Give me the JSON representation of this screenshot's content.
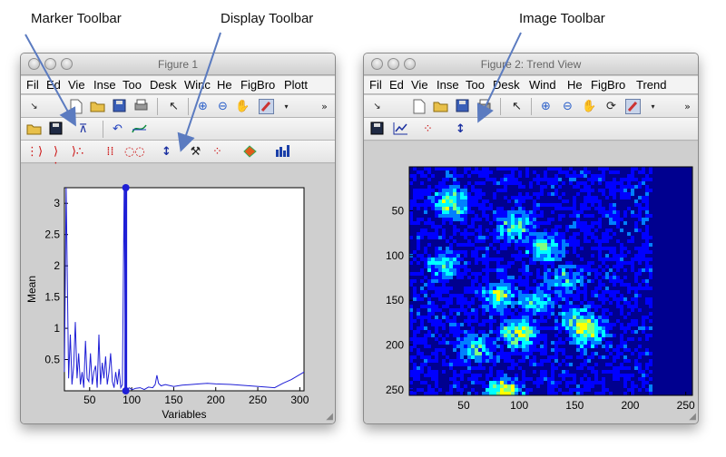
{
  "callouts": {
    "marker": "Marker Toolbar",
    "display": "Display Toolbar",
    "image": "Image Toolbar"
  },
  "window1": {
    "title": "Figure 1",
    "menu": [
      "Fil",
      "Ed",
      "Vie",
      "Inse",
      "Too",
      "Desk",
      "Winc",
      "He",
      "FigBro",
      "Plott"
    ],
    "chart_data": {
      "type": "line",
      "xlabel": "Variables",
      "ylabel": "Mean",
      "xlim": [
        20,
        305
      ],
      "ylim": [
        0,
        3.25
      ],
      "xticks": [
        50,
        100,
        150,
        200,
        250,
        300
      ],
      "yticks": [
        0.5,
        1,
        1.5,
        2,
        2.5,
        3
      ],
      "x": [
        20,
        22,
        25,
        27,
        29,
        31,
        33,
        35,
        37,
        39,
        41,
        43,
        45,
        47,
        49,
        51,
        53,
        55,
        57,
        59,
        61,
        63,
        65,
        67,
        69,
        71,
        73,
        75,
        77,
        79,
        81,
        83,
        85,
        87,
        89,
        91,
        93,
        95,
        97,
        99,
        101,
        105,
        110,
        115,
        120,
        125,
        128,
        130,
        132,
        135,
        140,
        150,
        160,
        170,
        180,
        190,
        200,
        220,
        240,
        260,
        270,
        280,
        290,
        300,
        305
      ],
      "y": [
        0.3,
        3.25,
        0.2,
        0.9,
        0.1,
        0.4,
        1.1,
        0.2,
        0.6,
        0.1,
        0.3,
        0.05,
        0.8,
        0.2,
        0.15,
        0.6,
        0.1,
        0.3,
        0.4,
        0.05,
        0.9,
        0.1,
        0.45,
        0.2,
        0.55,
        0.1,
        0.3,
        0.6,
        0.15,
        0.05,
        0.3,
        0.1,
        0.35,
        0.05,
        0.1,
        3.25,
        0.02,
        0.02,
        0.05,
        0.03,
        0.02,
        0.04,
        0.05,
        0.02,
        0.06,
        0.05,
        0.1,
        0.25,
        0.12,
        0.08,
        0.1,
        0.07,
        0.09,
        0.1,
        0.11,
        0.12,
        0.11,
        0.1,
        0.08,
        0.06,
        0.05,
        0.12,
        0.18,
        0.26,
        0.3
      ],
      "marker": {
        "x": 93,
        "y": 3.25
      },
      "series_color": "#1f1fd6"
    }
  },
  "window2": {
    "title": "Figure 2: Trend View",
    "menu": [
      "Fil",
      "Ed",
      "Vie",
      "Inse",
      "Too",
      "Desk",
      "Wind",
      "He",
      "FigBro",
      "Trend"
    ],
    "chart_data": {
      "type": "heatmap",
      "xlim": [
        1,
        256
      ],
      "ylim": [
        1,
        256
      ],
      "xticks": [
        50,
        100,
        150,
        200,
        250
      ],
      "yticks": [
        50,
        100,
        150,
        200,
        250
      ],
      "colormap": [
        "#00008f",
        "#0000ff",
        "#0080ff",
        "#00ffff",
        "#80ff80",
        "#ffff00"
      ],
      "background_color": "#00008f",
      "hotspots": [
        {
          "x": 38,
          "y": 40,
          "v": 0.8
        },
        {
          "x": 95,
          "y": 65,
          "v": 0.6
        },
        {
          "x": 80,
          "y": 143,
          "v": 0.7
        },
        {
          "x": 120,
          "y": 90,
          "v": 0.6
        },
        {
          "x": 140,
          "y": 125,
          "v": 0.5
        },
        {
          "x": 162,
          "y": 185,
          "v": 0.7
        },
        {
          "x": 98,
          "y": 185,
          "v": 0.9
        },
        {
          "x": 85,
          "y": 252,
          "v": 1.0
        },
        {
          "x": 60,
          "y": 200,
          "v": 0.5
        },
        {
          "x": 150,
          "y": 170,
          "v": 0.6
        },
        {
          "x": 30,
          "y": 110,
          "v": 0.5
        },
        {
          "x": 115,
          "y": 150,
          "v": 0.5
        }
      ]
    }
  }
}
